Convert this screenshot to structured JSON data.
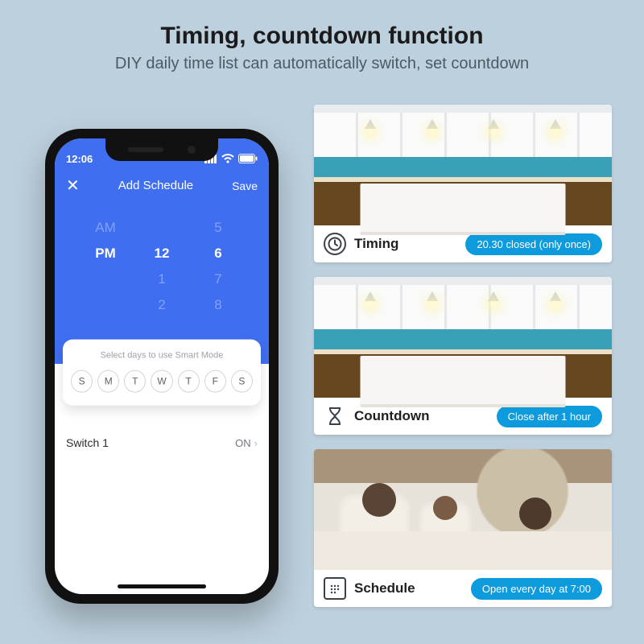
{
  "heading": {
    "title": "Timing, countdown function",
    "subtitle": "DIY daily time list can automatically switch, set countdown"
  },
  "phone": {
    "status": {
      "time": "12:06",
      "carrier_icon": "signal-icon",
      "wifi_icon": "wifi-icon",
      "battery_icon": "battery-icon"
    },
    "nav": {
      "close_icon": "close-icon",
      "title": "Add Schedule",
      "save": "Save"
    },
    "picker": {
      "ampm": {
        "above": "AM",
        "selected": "PM",
        "below": ""
      },
      "hour": {
        "above": "",
        "selected": "12",
        "below_1": "1",
        "below_2": "2"
      },
      "min": {
        "above": "5",
        "selected": "6",
        "below_1": "7",
        "below_2": "8"
      }
    },
    "days": {
      "hint": "Select days to use Smart Mode",
      "labels": [
        "S",
        "M",
        "T",
        "W",
        "T",
        "F",
        "S"
      ]
    },
    "switch_row": {
      "name": "Switch 1",
      "state": "ON",
      "chevron": "›"
    }
  },
  "features": [
    {
      "icon": "clock-icon",
      "label": "Timing",
      "pill": "20.30 closed (only once)",
      "scene": "kitchen"
    },
    {
      "icon": "hourglass-icon",
      "label": "Countdown",
      "pill": "Close after 1 hour",
      "scene": "kitchen"
    },
    {
      "icon": "calendar-icon",
      "label": "Schedule",
      "pill": "Open every day at 7:00",
      "scene": "bedroom"
    }
  ]
}
